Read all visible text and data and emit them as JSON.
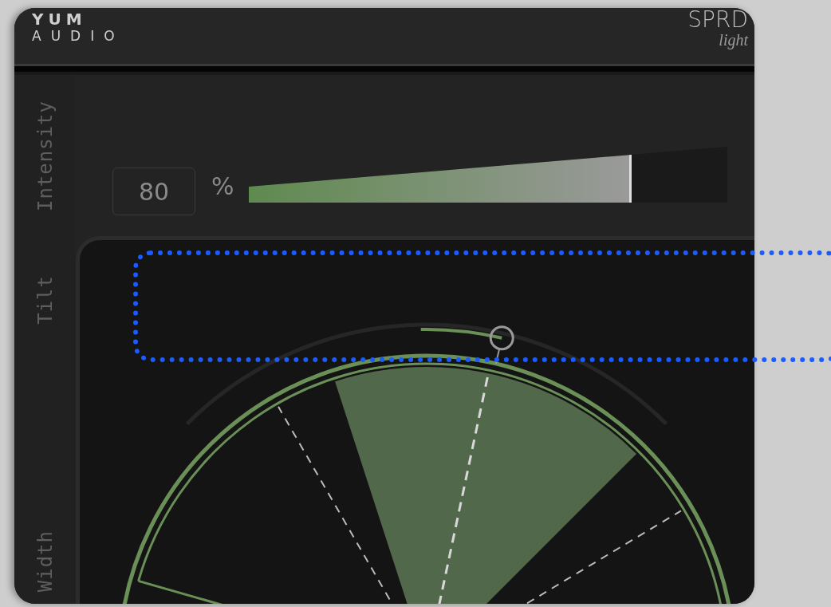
{
  "header": {
    "brand_mark": "YUM",
    "brand_left": "AUDIO",
    "brand_right": "SPRD",
    "brand_right_sub": "light"
  },
  "side_labels": [
    {
      "label": "Intensity"
    },
    {
      "label": "Tilt"
    },
    {
      "label": "Width"
    }
  ],
  "intensity": {
    "value": "80",
    "unit": "%",
    "level": 0.8
  }
}
